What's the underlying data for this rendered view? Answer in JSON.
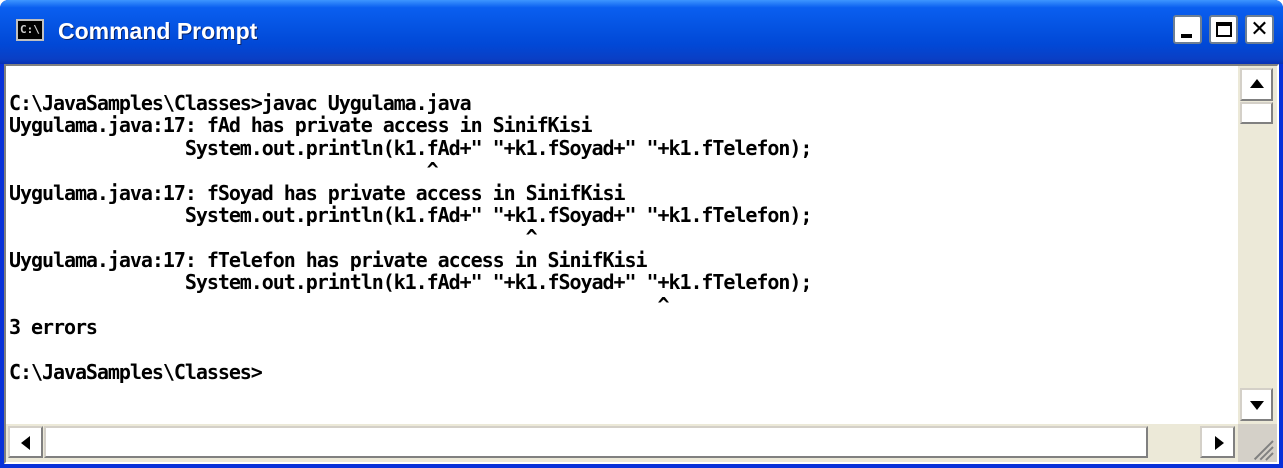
{
  "window": {
    "title": "Command Prompt",
    "icon": "cmd-icon",
    "icon_label": "C:\\"
  },
  "controls": {
    "minimize_icon": "minimize-icon",
    "maximize_icon": "maximize-icon",
    "close_icon": "close-icon",
    "close_glyph": "✕"
  },
  "console": {
    "lines": [
      "C:\\JavaSamples\\Classes>javac Uygulama.java",
      "Uygulama.java:17: fAd has private access in SinifKisi",
      "                System.out.println(k1.fAd+\" \"+k1.fSoyad+\" \"+k1.fTelefon);",
      "                                      ^",
      "Uygulama.java:17: fSoyad has private access in SinifKisi",
      "                System.out.println(k1.fAd+\" \"+k1.fSoyad+\" \"+k1.fTelefon);",
      "                                               ^",
      "Uygulama.java:17: fTelefon has private access in SinifKisi",
      "                System.out.println(k1.fAd+\" \"+k1.fSoyad+\" \"+k1.fTelefon);",
      "                                                           ^",
      "3 errors",
      "",
      "C:\\JavaSamples\\Classes>"
    ]
  },
  "scrollbars": {
    "vertical": {
      "up_icon": "arrow-up-icon",
      "down_icon": "arrow-down-icon"
    },
    "horizontal": {
      "left_icon": "arrow-left-icon",
      "right_icon": "arrow-right-icon"
    }
  },
  "colors": {
    "titlebar": "#0554e3",
    "console_bg": "#ffffff",
    "console_text": "#000000"
  }
}
